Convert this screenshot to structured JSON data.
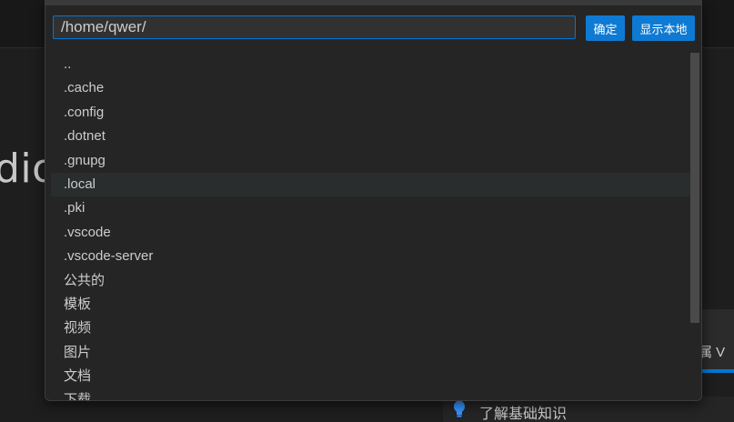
{
  "background": {
    "big_text": "dio",
    "card_text": "属 V",
    "tip_text": "了解基础知识"
  },
  "picker": {
    "path_value": "/home/qwer/",
    "confirm_label": "确定",
    "show_local_label": "显示本地",
    "hovered_index": 5,
    "items": [
      "..",
      ".cache",
      ".config",
      ".dotnet",
      ".gnupg",
      ".local",
      ".pki",
      ".vscode",
      ".vscode-server",
      "公共的",
      "模板",
      "视频",
      "图片",
      "文档",
      "下载"
    ]
  },
  "colors": {
    "accent": "#0078d4",
    "button": "#0e7ad3",
    "panel": "#252526",
    "editor_bg": "#1e1e1e"
  }
}
